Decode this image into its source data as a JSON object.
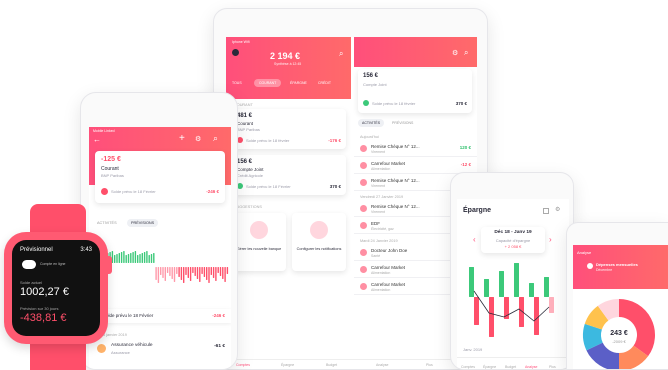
{
  "tablet": {
    "carrier": "Iphone Wifi",
    "balance": "2 194 €",
    "balance_sub": "Synthèse à 12:45",
    "tabs": [
      "TOUS",
      "COURANT",
      "ÉPARGNE",
      "CRÉDIT"
    ],
    "section_courant": "COURANT",
    "acc1_amount": "481 €",
    "acc1_name": "Courant",
    "acc1_bank": "BNP Paribas",
    "acc1_forecast": "Solde prévu le 18 février",
    "acc1_forecast_val": "-176 €",
    "acc2_amount": "156 €",
    "acc2_name": "Compte Joint",
    "acc2_bank": "Crédit Agricole",
    "acc2_forecast": "Solde prévu le 18 Février",
    "acc2_forecast_val": "370 €",
    "section_suggestions": "SUGGESTIONS",
    "sugg1_title": "Gérer les nouvelle banque",
    "sugg2_title": "Configurer les notifications",
    "detail_amount": "156 €",
    "detail_name": "Compte Joint",
    "detail_forecast": "Solde prévu le 18 février",
    "detail_forecast_val": "370 €",
    "detail_tabs": [
      "ACTIVITÉS",
      "PRÉVISIONS"
    ],
    "date1": "Aujourd'hui",
    "date2": "Vendredi 27 Janvier 2019",
    "date3": "Mardi 24 Janvier 2019",
    "transactions": [
      {
        "title": "Remise Chèque N° 12...",
        "sub": "Virement",
        "val": "120 €",
        "kind": "pos"
      },
      {
        "title": "Carrefour Market",
        "sub": "Alimentation",
        "val": "-12 €",
        "kind": "neg"
      },
      {
        "title": "Remise Chèque N° 12...",
        "sub": "Virement",
        "val": "120 €",
        "kind": "pos"
      },
      {
        "title": "Remise Chèque N° 12...",
        "sub": "Virement",
        "val": "120 €",
        "kind": "pos"
      },
      {
        "title": "EDF",
        "sub": "Électricité, gaz",
        "val": "-48 €",
        "kind": "neg"
      },
      {
        "title": "Docteur John Doe",
        "sub": "Santé",
        "val": "-25 €",
        "kind": "neg"
      },
      {
        "title": "Carrefour Market",
        "sub": "Alimentation",
        "val": "-31 €",
        "kind": "neg"
      },
      {
        "title": "Carrefour Market",
        "sub": "Alimentation",
        "val": "-9 €",
        "kind": "neg"
      }
    ],
    "nav": [
      "Comptes",
      "Épargne",
      "Budget",
      "Analyse",
      "Plus"
    ]
  },
  "phone": {
    "carrier": "Mobile Linked",
    "amount": "-125 €",
    "name": "Courant",
    "bank": "BNP Paribas",
    "forecast": "Solde prévu le 18 Février",
    "forecast_val": "-246 €",
    "tabs": [
      "ACTIVITÉS",
      "PRÉVISIONS"
    ],
    "forecast_line": "Solde prévu le 18 Février",
    "forecast_line_val": "-246 €",
    "date": "5 janvier 2019",
    "txn_title": "Assurance véhicule",
    "txn_sub": "Assurance",
    "txn_val": "-61 €"
  },
  "watch": {
    "title": "Prévisionnel",
    "time": "3:43",
    "subtitle": "Compte en ligne",
    "label1": "Solde actuel",
    "amount1": "1002,27 €",
    "label2": "Prévision sur 30 jours",
    "amount2": "-438,81 €"
  },
  "phone2": {
    "title": "Épargne",
    "period": "Déc 18 - Janv 19",
    "period_sub": "Capacité d'épargne",
    "period_val": "+ 2 058 €",
    "month_label": "Janv. 2019",
    "nav": [
      "Comptes",
      "Épargne",
      "Budget",
      "Analyse",
      "Plus"
    ]
  },
  "phone3": {
    "title": "Analyse",
    "legend_title": "Dépenses mensuelles",
    "legend_sub": "Décembre",
    "center_val": "243 €",
    "center_sub": "-2009 €"
  },
  "colors": {
    "accent": "#ff4f7b",
    "positive": "#2bbf6a",
    "negative": "#ff4f6a"
  }
}
